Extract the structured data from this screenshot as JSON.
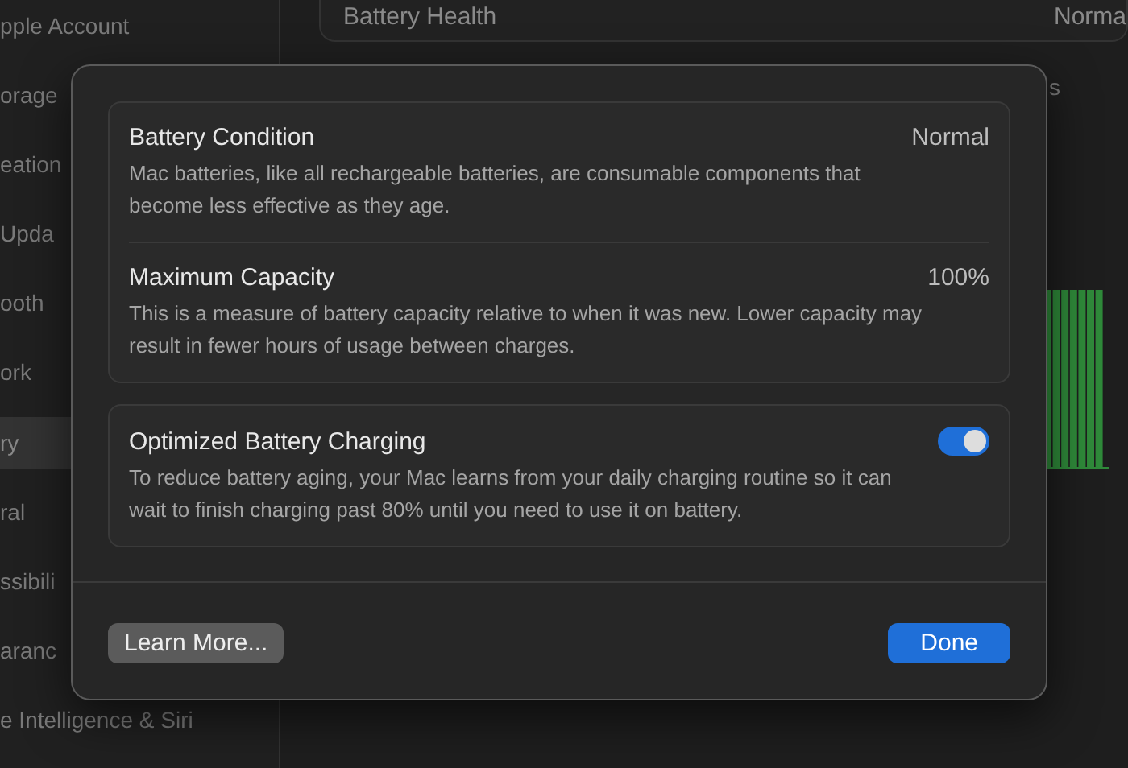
{
  "sidebar": {
    "items": [
      {
        "label": "pple Account",
        "selected": false
      },
      {
        "label": "orage",
        "selected": false
      },
      {
        "label": "eation",
        "selected": false
      },
      {
        "label": "Upda",
        "selected": false
      },
      {
        "label": "ooth",
        "selected": false
      },
      {
        "label": "ork",
        "selected": false
      },
      {
        "label": "ry",
        "selected": true
      },
      {
        "label": "ral",
        "selected": false
      },
      {
        "label": "ssibili",
        "selected": false
      },
      {
        "label": "aranc",
        "selected": false
      },
      {
        "label": "e Intelligence & Siri",
        "selected": false
      }
    ]
  },
  "main": {
    "battery_health": {
      "label": "Battery Health",
      "value": "Norma"
    },
    "section_label": "s"
  },
  "dialog": {
    "sections": [
      {
        "kind": "info",
        "rows": [
          {
            "title": "Battery Condition",
            "value": "Normal",
            "description": "Mac batteries, like all rechargeable batteries, are consumable components that become less effective as they age."
          },
          {
            "title": "Maximum Capacity",
            "value": "100%",
            "description": "This is a measure of battery capacity relative to when it was new. Lower capacity may result in fewer hours of usage between charges."
          }
        ]
      },
      {
        "kind": "toggle",
        "rows": [
          {
            "title": "Optimized Battery Charging",
            "on": true,
            "description": "To reduce battery aging, your Mac learns from your daily charging routine so it can wait to finish charging past 80% until you need to use it on battery."
          }
        ]
      }
    ],
    "buttons": [
      {
        "label": "Learn More...",
        "kind": "secondary"
      },
      {
        "label": "Done",
        "kind": "primary"
      }
    ]
  }
}
